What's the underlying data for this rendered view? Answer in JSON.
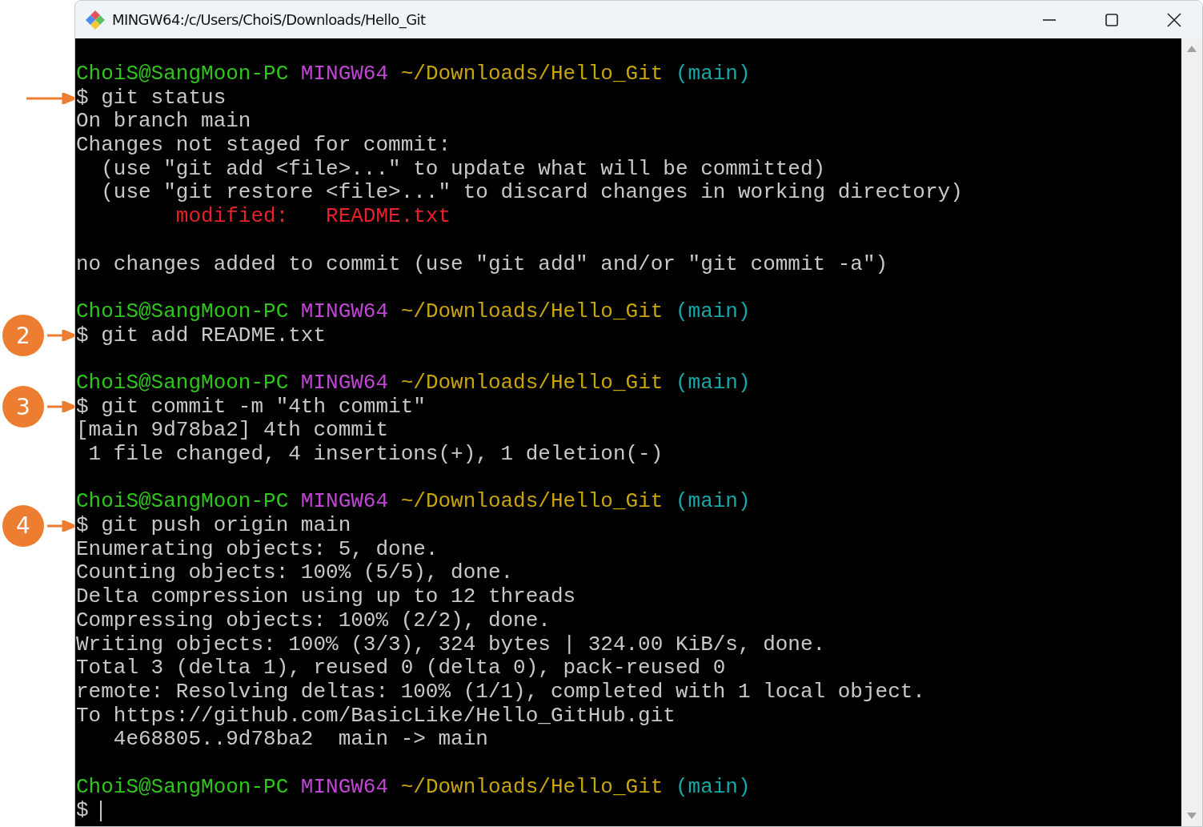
{
  "window": {
    "title": "MINGW64:/c/Users/ChoiS/Downloads/Hello_Git"
  },
  "blocks": [
    {
      "marker": {
        "kind": "arrow"
      },
      "prompt": {
        "user": "ChoiS@SangMoon-PC",
        "system": "MINGW64",
        "path": "~/Downloads/Hello_Git",
        "branch": "(main)"
      },
      "command": "$ git status",
      "cursor": false,
      "output": [
        {
          "kind": "plain",
          "text": "On branch main"
        },
        {
          "kind": "plain",
          "text": "Changes not staged for commit:"
        },
        {
          "kind": "plain",
          "text": "  (use \"git add <file>...\" to update what will be committed)"
        },
        {
          "kind": "plain",
          "text": "  (use \"git restore <file>...\" to discard changes in working directory)"
        },
        {
          "kind": "colored",
          "text": "        modified:   README.txt",
          "color": "#e8202a"
        },
        {
          "kind": "blank"
        },
        {
          "kind": "plain",
          "text": "no changes added to commit (use \"git add\" and/or \"git commit -a\")"
        }
      ]
    },
    {
      "marker": {
        "kind": "badge",
        "number": "2"
      },
      "prompt": {
        "user": "ChoiS@SangMoon-PC",
        "system": "MINGW64",
        "path": "~/Downloads/Hello_Git",
        "branch": "(main)"
      },
      "command": "$ git add README.txt",
      "cursor": false
    },
    {
      "marker": {
        "kind": "badge",
        "number": "3"
      },
      "prompt": {
        "user": "ChoiS@SangMoon-PC",
        "system": "MINGW64",
        "path": "~/Downloads/Hello_Git",
        "branch": "(main)"
      },
      "command": "$ git commit -m \"4th commit\"",
      "cursor": false,
      "output": [
        {
          "kind": "plain",
          "text": "[main 9d78ba2] 4th commit"
        },
        {
          "kind": "plain",
          "text": " 1 file changed, 4 insertions(+), 1 deletion(-)"
        }
      ]
    },
    {
      "marker": {
        "kind": "badge",
        "number": "4"
      },
      "prompt": {
        "user": "ChoiS@SangMoon-PC",
        "system": "MINGW64",
        "path": "~/Downloads/Hello_Git",
        "branch": "(main)"
      },
      "command": "$ git push origin main",
      "cursor": false,
      "output": [
        {
          "kind": "plain",
          "text": "Enumerating objects: 5, done."
        },
        {
          "kind": "plain",
          "text": "Counting objects: 100% (5/5), done."
        },
        {
          "kind": "plain",
          "text": "Delta compression using up to 12 threads"
        },
        {
          "kind": "plain",
          "text": "Compressing objects: 100% (2/2), done."
        },
        {
          "kind": "plain",
          "text": "Writing objects: 100% (3/3), 324 bytes | 324.00 KiB/s, done."
        },
        {
          "kind": "plain",
          "text": "Total 3 (delta 1), reused 0 (delta 0), pack-reused 0"
        },
        {
          "kind": "plain",
          "text": "remote: Resolving deltas: 100% (1/1), completed with 1 local object."
        },
        {
          "kind": "plain",
          "text": "To https://github.com/BasicLike/Hello_GitHub.git"
        },
        {
          "kind": "plain",
          "text": "   4e68805..9d78ba2  main -> main"
        }
      ]
    },
    {
      "prompt": {
        "user": "ChoiS@SangMoon-PC",
        "system": "MINGW64",
        "path": "~/Downloads/Hello_Git",
        "branch": "(main)"
      },
      "command": "$",
      "cursor": true
    }
  ]
}
